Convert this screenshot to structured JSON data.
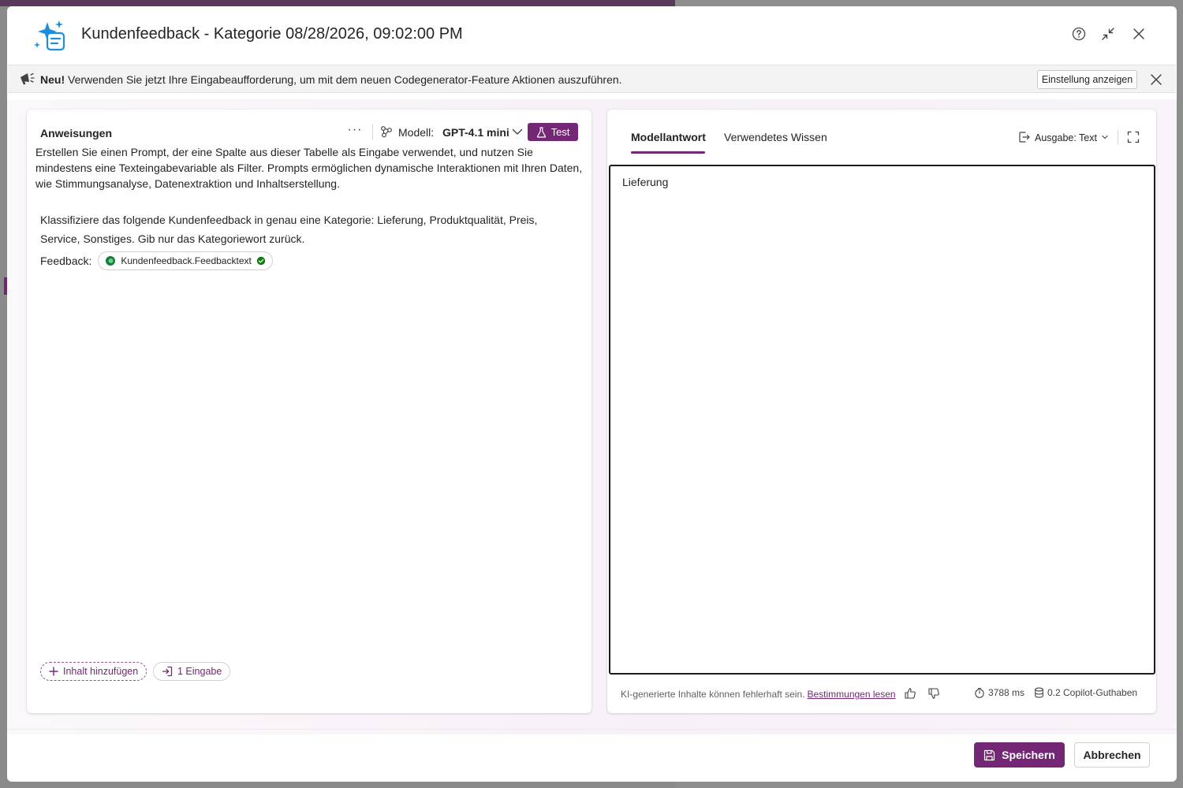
{
  "dialog": {
    "title": "Kundenfeedback - Kategorie 08/28/2026, 09:02:00 PM",
    "icons": {
      "logo": "copilot-prompt-icon",
      "help": "help-icon",
      "collapse": "collapse-icon",
      "close": "close-icon"
    }
  },
  "notice": {
    "bold": "Neu!",
    "text": " Verwenden Sie jetzt Ihre Eingabeaufforderung, um mit dem neuen Codegenerator-Feature Aktionen auszuführen.",
    "button": "Einstellung anzeigen",
    "icon": "megaphone-icon"
  },
  "instructions": {
    "title": "Anweisungen",
    "more": "···",
    "model_label": "Modell:",
    "model_value": "GPT-4.1 mini",
    "test_button": "Test",
    "description": "Erstellen Sie einen Prompt, der eine Spalte aus dieser Tabelle als Eingabe verwendet, und nutzen Sie mindestens eine Texteingabevariable als Filter. Prompts ermöglichen dynamische Interaktionen mit Ihren Daten, wie Stimmungsanalyse, Datenextraktion und Inhaltserstellung.",
    "prompt": "Klassifiziere das folgende Kundenfeedback in genau eine Kategorie: Lieferung, Produktqualität, Preis, Service, Sonstiges. Gib nur das Kategoriewort zurück.",
    "feedback_label": "Feedback:",
    "variable_chip": "Kundenfeedback.Feedbacktext",
    "add_content": "Inhalt hinzufügen",
    "inputs": "1 Eingabe"
  },
  "response": {
    "tabs": [
      "Modellantwort",
      "Verwendetes Wissen"
    ],
    "active_tab": "Modellantwort",
    "output_label": "Ausgabe:",
    "output_value": "Text",
    "text": "Lieferung",
    "disclaimer": "KI-generierte Inhalte können fehlerhaft sein.",
    "terms_link": "Bestimmungen lesen",
    "duration": "3788 ms",
    "credits": "0.2 Copilot-Guthaben"
  },
  "footer": {
    "save": "Speichern",
    "cancel": "Abbrechen"
  },
  "colors": {
    "accent": "#742774",
    "success": "#107c10"
  }
}
